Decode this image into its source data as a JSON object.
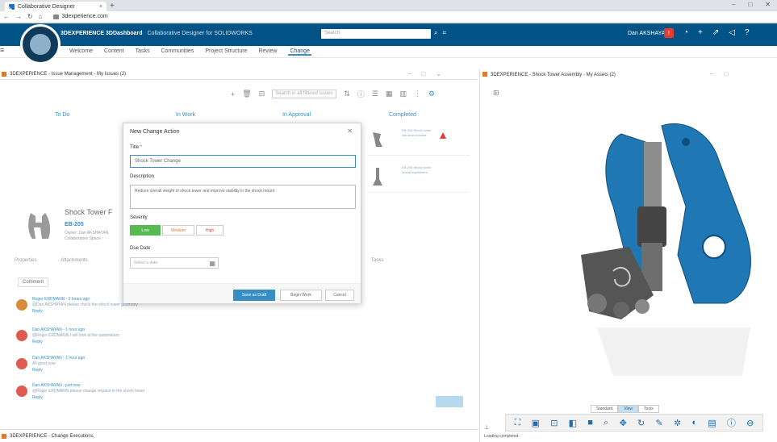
{
  "browser": {
    "tab_label": "Collaborative Designer",
    "url": "3dexperience.com"
  },
  "header": {
    "brand": "3DEXPERIENCE",
    "app": "3DDashboard",
    "subtitle": "Collaborative Designer for SOLIDWORKS",
    "search_placeholder": "Search",
    "user": "Dan AKSHAYAN"
  },
  "subnav": {
    "tabs": [
      "Welcome",
      "Content",
      "Tasks",
      "Communities",
      "Project Structure",
      "Review",
      "Change"
    ],
    "active_index": 6
  },
  "left_panel": {
    "title": "3DEXPERIENCE - Issue Management - My Issues (2)",
    "filter_placeholder": "Search in all filtered issues",
    "columns": [
      "To Do",
      "In Work",
      "In Approval",
      "Completed"
    ]
  },
  "issue": {
    "title": "Shock Tower F",
    "id": "EB-205",
    "meta": "Owner: Dan AKSHAYAN Collaborative Space"
  },
  "kanban_cards": [
    {
      "text": "EB-205 Shock tower link inner bracket"
    },
    {
      "text": "EB-206 Shock tower mount adjustment"
    }
  ],
  "row_tabs": [
    "Properties",
    "Attachments"
  ],
  "row_tab_right": "Tasks",
  "comment_filter": "Comment",
  "comments": [
    {
      "name": "Roger ERDMANN - 2 hours ago",
      "text": "@Dan AKSHAYAN please check the shock tower geometry",
      "reply": "Reply",
      "color": "#d88a3a"
    },
    {
      "name": "Dan AKSHAYAN - 1 hour ago",
      "text": "@Roger ERDMANN I will look at the parameters",
      "reply": "Reply",
      "color": "#e05b4f"
    },
    {
      "name": "Dan AKSHAYAN - 1 hour ago",
      "text": "All good now",
      "reply": "Reply",
      "color": "#e05b4f"
    },
    {
      "name": "Dan AKSHAYAN - just now",
      "text": "@Roger ERDMANN please change request to the shock tower",
      "reply": "Reply",
      "color": "#e05b4f"
    }
  ],
  "bottom_panel": {
    "title": "3DEXPERIENCE - Change Executions"
  },
  "dialog": {
    "title": "New Change Action",
    "title_label": "Title",
    "title_value": "Shock Tower Change",
    "description_label": "Description",
    "description_value": "Reduce overall weight of shock tower and improve stability in the shock mount",
    "severity_label": "Severity",
    "severity_options": [
      "Low",
      "Medium",
      "High"
    ],
    "selected_severity": "Low",
    "due_label": "Due Date",
    "due_placeholder": "Select a date",
    "buttons": {
      "primary": "Save as Draft",
      "secondary": "Begin Work",
      "cancel": "Cancel"
    }
  },
  "right_panel": {
    "title": "3DEXPERIENCE - Shock Tower Assembly - My Assets (2)",
    "view_tabs": [
      "Standard",
      "View",
      "Tools"
    ],
    "active_view_tab": 1,
    "status": "Loading completed"
  },
  "colors": {
    "header_bg": "#005386",
    "accent": "#368ec4",
    "model_blue": "#1f77b4",
    "warning": "#e03c31",
    "success": "#57b952"
  }
}
